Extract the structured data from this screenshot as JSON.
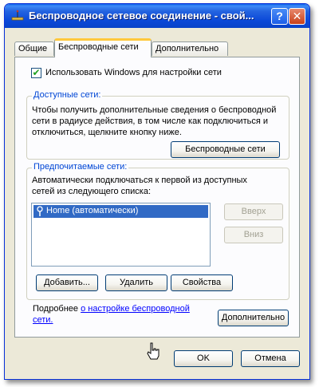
{
  "window": {
    "title": "Беспроводное сетевое соединение - свой...",
    "help_label": "?",
    "close_label": "✕"
  },
  "tabs": [
    {
      "label": "Общие"
    },
    {
      "label": "Беспроводные сети"
    },
    {
      "label": "Дополнительно"
    }
  ],
  "settings": {
    "use_windows_checkbox": "Использовать Windows для настройки сети"
  },
  "available_networks": {
    "title": "Доступные сети:",
    "line1": "Чтобы получить дополнительные сведения о беспроводной",
    "line2": "сети в радиусе действия, в том числе как подключиться и",
    "line3": "отключиться, щелкните кнопку ниже.",
    "button": "Беспроводные сети"
  },
  "preferred_networks": {
    "title": "Предпочитаемые сети:",
    "line1": "Автоматически подключаться к первой из доступных",
    "line2": "сетей из следующего списка:",
    "items": [
      "Home (автоматически)"
    ],
    "up_button": "Вверх",
    "down_button": "Вниз",
    "add_button": "Добавить...",
    "remove_button": "Удалить",
    "properties_button": "Свойства"
  },
  "footer_info": {
    "prefix": "Подробнее ",
    "link_part1": "о настройке беспроводной",
    "link_part2": "сети.",
    "advanced_button": "Дополнительно"
  },
  "dialog": {
    "ok": "OK",
    "cancel": "Отмена"
  }
}
